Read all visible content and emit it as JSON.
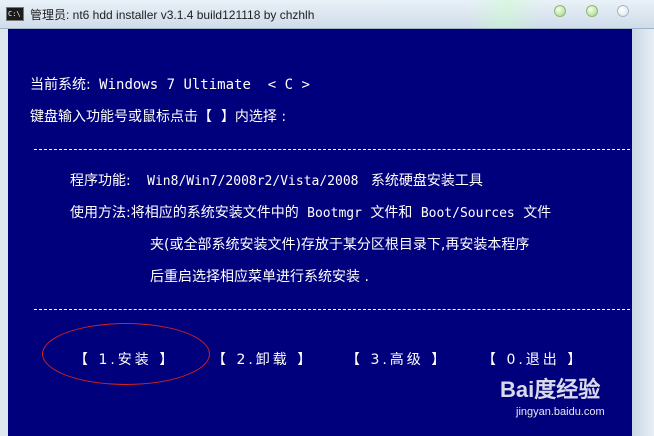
{
  "window": {
    "title": "管理员:  nt6 hdd installer v3.1.4 build121118 by chzhlh",
    "icon_label": "C:\\",
    "controls": [
      "minimize-icon",
      "maximize-icon",
      "close-icon"
    ]
  },
  "console": {
    "background": "#00007d",
    "text_color": "#ffffff",
    "current_system_label": "当前系统:",
    "current_system_value": "Windows 7 Ultimate  < C >",
    "prompt_prefix": "键盘输入功能号或鼠标点击",
    "prompt_bracket_left": "【",
    "prompt_bracket_right": "】",
    "prompt_suffix": "内选择 :",
    "separator": "-------------------------------------------------------------------",
    "function_label": "程序功能:",
    "function_os": "Win8/Win7/2008r2/Vista/2008",
    "function_desc": "系统硬盘安装工具",
    "usage_label": "使用方法:",
    "usage_line1_a": "将相应的系统安装文件中的",
    "usage_line1_b": "Bootmgr",
    "usage_line1_c": "文件和",
    "usage_line1_d": "Boot/Sources",
    "usage_line1_e": "文件",
    "usage_line2": "夹(或全部系统安装文件)存放于某分区根目录下,再安装本程序",
    "usage_line3": "后重启选择相应菜单进行系统安装 ."
  },
  "menu": [
    {
      "label": "【 1.安装 】",
      "name": "menu-install-button"
    },
    {
      "label": "【 2.卸载 】",
      "name": "menu-uninstall-button"
    },
    {
      "label": "【 3.高级 】",
      "name": "menu-advanced-button"
    },
    {
      "label": "【 0.退出 】",
      "name": "menu-exit-button"
    }
  ],
  "annotation": {
    "highlight_color": "#d32020",
    "highlighted_item": "menu-install-button"
  },
  "watermark": {
    "logo_text": "Bai度经验",
    "site": "jingyan.baidu.com"
  }
}
